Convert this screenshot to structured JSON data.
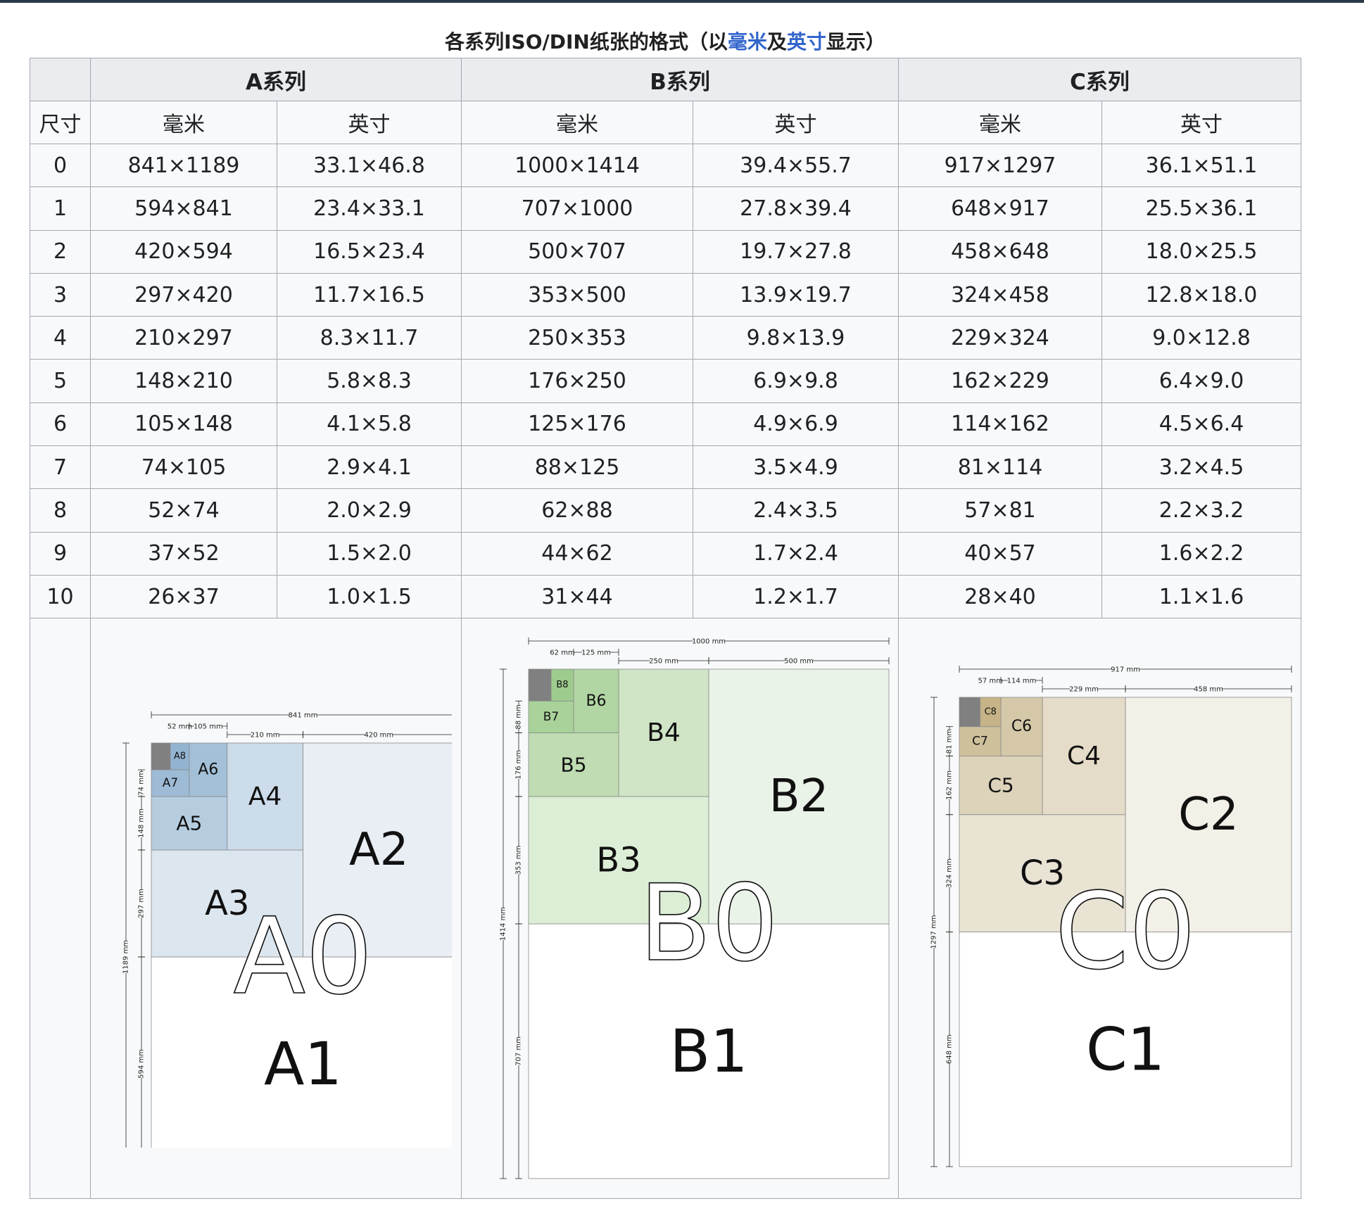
{
  "caption": {
    "prefix": "各系列ISO/DIN纸张的格式（以",
    "link_mm": "毫米",
    "middle": "及",
    "link_in": "英寸",
    "suffix": "显示）"
  },
  "table": {
    "series_headers": [
      "A系列",
      "B系列",
      "C系列"
    ],
    "size_header": "尺寸",
    "unit_mm": "毫米",
    "unit_in": "英寸",
    "rows": [
      {
        "size": "0",
        "a_mm": "841×1189",
        "a_in": "33.1×46.8",
        "b_mm": "1000×1414",
        "b_in": "39.4×55.7",
        "c_mm": "917×1297",
        "c_in": "36.1×51.1"
      },
      {
        "size": "1",
        "a_mm": "594×841",
        "a_in": "23.4×33.1",
        "b_mm": "707×1000",
        "b_in": "27.8×39.4",
        "c_mm": "648×917",
        "c_in": "25.5×36.1"
      },
      {
        "size": "2",
        "a_mm": "420×594",
        "a_in": "16.5×23.4",
        "b_mm": "500×707",
        "b_in": "19.7×27.8",
        "c_mm": "458×648",
        "c_in": "18.0×25.5"
      },
      {
        "size": "3",
        "a_mm": "297×420",
        "a_in": "11.7×16.5",
        "b_mm": "353×500",
        "b_in": "13.9×19.7",
        "c_mm": "324×458",
        "c_in": "12.8×18.0"
      },
      {
        "size": "4",
        "a_mm": "210×297",
        "a_in": "8.3×11.7",
        "b_mm": "250×353",
        "b_in": "9.8×13.9",
        "c_mm": "229×324",
        "c_in": "9.0×12.8"
      },
      {
        "size": "5",
        "a_mm": "148×210",
        "a_in": "5.8×8.3",
        "b_mm": "176×250",
        "b_in": "6.9×9.8",
        "c_mm": "162×229",
        "c_in": "6.4×9.0"
      },
      {
        "size": "6",
        "a_mm": "105×148",
        "a_in": "4.1×5.8",
        "b_mm": "125×176",
        "b_in": "4.9×6.9",
        "c_mm": "114×162",
        "c_in": "4.5×6.4"
      },
      {
        "size": "7",
        "a_mm": "74×105",
        "a_in": "2.9×4.1",
        "b_mm": "88×125",
        "b_in": "3.5×4.9",
        "c_mm": "81×114",
        "c_in": "3.2×4.5"
      },
      {
        "size": "8",
        "a_mm": "52×74",
        "a_in": "2.0×2.9",
        "b_mm": "62×88",
        "b_in": "2.4×3.5",
        "c_mm": "57×81",
        "c_in": "2.2×3.2"
      },
      {
        "size": "9",
        "a_mm": "37×52",
        "a_in": "1.5×2.0",
        "b_mm": "44×62",
        "b_in": "1.7×2.4",
        "c_mm": "40×57",
        "c_in": "1.6×2.2"
      },
      {
        "size": "10",
        "a_mm": "26×37",
        "a_in": "1.0×1.5",
        "b_mm": "31×44",
        "b_in": "1.2×1.7",
        "c_mm": "28×40",
        "c_in": "1.1×1.6"
      }
    ]
  },
  "diagrams": [
    {
      "series": "A",
      "big_label": "A0",
      "labels": [
        "A1",
        "A2",
        "A3",
        "A4",
        "A5",
        "A6",
        "A7",
        "A8"
      ],
      "dims_top": [
        "841 mm",
        "52 mm",
        "105 mm",
        "210 mm",
        "420 mm"
      ],
      "dims_side": [
        "74 mm",
        "148 mm",
        "297 mm",
        "594 mm",
        "1189 mm"
      ],
      "colors": {
        "c2": "#e8eef3",
        "c3": "#dce6ee",
        "c4": "#cddcea",
        "c5": "#b6cde0",
        "c6": "#a3c0d8",
        "c7": "#9dbbd5",
        "c8": "#93b4d0",
        "corner": "#808080"
      }
    },
    {
      "series": "B",
      "big_label": "B0",
      "labels": [
        "B1",
        "B2",
        "B3",
        "B4",
        "B5",
        "B6",
        "B7",
        "B8"
      ],
      "dims_top": [
        "1000 mm",
        "62 mm",
        "125 mm",
        "250 mm",
        "500 mm"
      ],
      "dims_side": [
        "88 mm",
        "176 mm",
        "353 mm",
        "707 mm",
        "1414 mm"
      ],
      "colors": {
        "c2": "#eaf3e7",
        "c3": "#dceed6",
        "c4": "#cfe5c6",
        "c5": "#bfdcb2",
        "c6": "#b1d6a3",
        "c7": "#a9d29a",
        "c8": "#9ecb8e",
        "corner": "#808080"
      }
    },
    {
      "series": "C",
      "big_label": "C0",
      "labels": [
        "C1",
        "C2",
        "C3",
        "C4",
        "C5",
        "C6",
        "C7",
        "C8"
      ],
      "dims_top": [
        "917 mm",
        "57 mm",
        "114 mm",
        "229 mm",
        "458 mm"
      ],
      "dims_side": [
        "81 mm",
        "162 mm",
        "324 mm",
        "648 mm",
        "1297 mm"
      ],
      "colors": {
        "c2": "#f3f0e8",
        "c3": "#e9e3d4",
        "c4": "#e4dcc8",
        "c5": "#ddd2ba",
        "c6": "#d5c8a8",
        "c7": "#cfc09c",
        "c8": "#c6b387",
        "corner": "#808080"
      }
    }
  ]
}
